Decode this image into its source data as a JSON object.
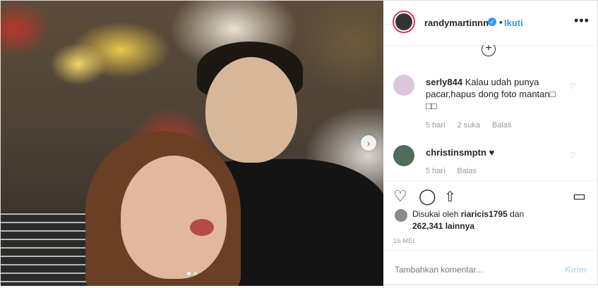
{
  "post": {
    "username": "randymartinnn",
    "separator": "•",
    "follow_label": "Ikuti",
    "more_label": "•••"
  },
  "comments": [
    {
      "username": "serly844",
      "text": "Kalau udah punya pacar,hapus dong foto mantan□ □□",
      "time": "5 hari",
      "likes": "2 suka",
      "reply": "Balas"
    },
    {
      "username": "christinsmptn",
      "text": "♥",
      "time": "5 hari",
      "reply": "Balas"
    }
  ],
  "likes": {
    "prefix": "Disukai oleh",
    "user": "riaricis1795",
    "suffix": "dan",
    "count": "262,341 lainnya"
  },
  "date": "16 MEI",
  "comment_input": {
    "placeholder": "Tambahkan komentar..."
  },
  "post_button": "Kirim",
  "colors": {
    "accent": "#3897f0",
    "text": "#262626",
    "muted": "#999999"
  }
}
